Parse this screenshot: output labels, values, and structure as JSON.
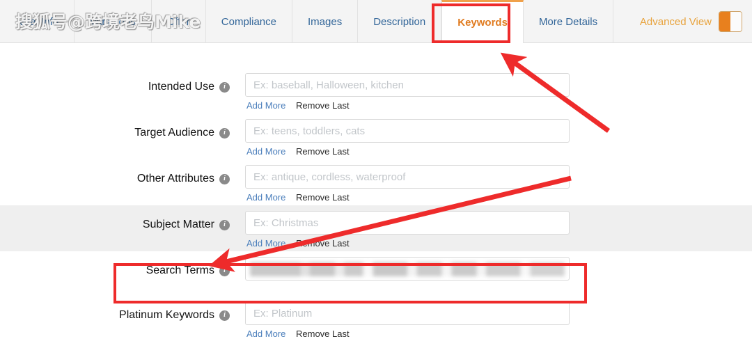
{
  "watermark": {
    "text": "搜狐号@跨境老鸟Mike"
  },
  "tabs": [
    {
      "label": "Vital Info",
      "active": false
    },
    {
      "label": "Variations",
      "active": false
    },
    {
      "label": "Offer",
      "active": false
    },
    {
      "label": "Compliance",
      "active": false
    },
    {
      "label": "Images",
      "active": false
    },
    {
      "label": "Description",
      "active": false
    },
    {
      "label": "Keywords",
      "active": true
    },
    {
      "label": "More Details",
      "active": false
    }
  ],
  "advanced_view": {
    "label": "Advanced View",
    "toggle_state": "on",
    "accent_color": "#e8801e"
  },
  "form": {
    "add_more_label": "Add More",
    "remove_last_label": "Remove Last",
    "rows": [
      {
        "label": "Intended Use",
        "placeholder": "Ex: baseball, Halloween, kitchen",
        "value": "",
        "shaded": false,
        "has_links": true,
        "redacted": false
      },
      {
        "label": "Target Audience",
        "placeholder": "Ex: teens, toddlers, cats",
        "value": "",
        "shaded": false,
        "has_links": true,
        "redacted": false
      },
      {
        "label": "Other Attributes",
        "placeholder": "Ex: antique, cordless, waterproof",
        "value": "",
        "shaded": false,
        "has_links": true,
        "redacted": false
      },
      {
        "label": "Subject Matter",
        "placeholder": "Ex: Christmas",
        "value": "",
        "shaded": true,
        "has_links": true,
        "redacted": false
      },
      {
        "label": "Search Terms",
        "placeholder": "",
        "value": "",
        "shaded": false,
        "has_links": false,
        "redacted": true
      },
      {
        "label": "Platinum Keywords",
        "placeholder": "Ex: Platinum",
        "value": "",
        "shaded": false,
        "has_links": true,
        "redacted": false
      }
    ]
  },
  "annotations": {
    "color": "#ee2b2b",
    "highlight_boxes": [
      {
        "target": "Keywords tab"
      },
      {
        "target": "Search Terms field"
      }
    ],
    "arrows": [
      {
        "points_to": "Keywords tab"
      },
      {
        "points_to": "Search Terms field"
      }
    ]
  }
}
